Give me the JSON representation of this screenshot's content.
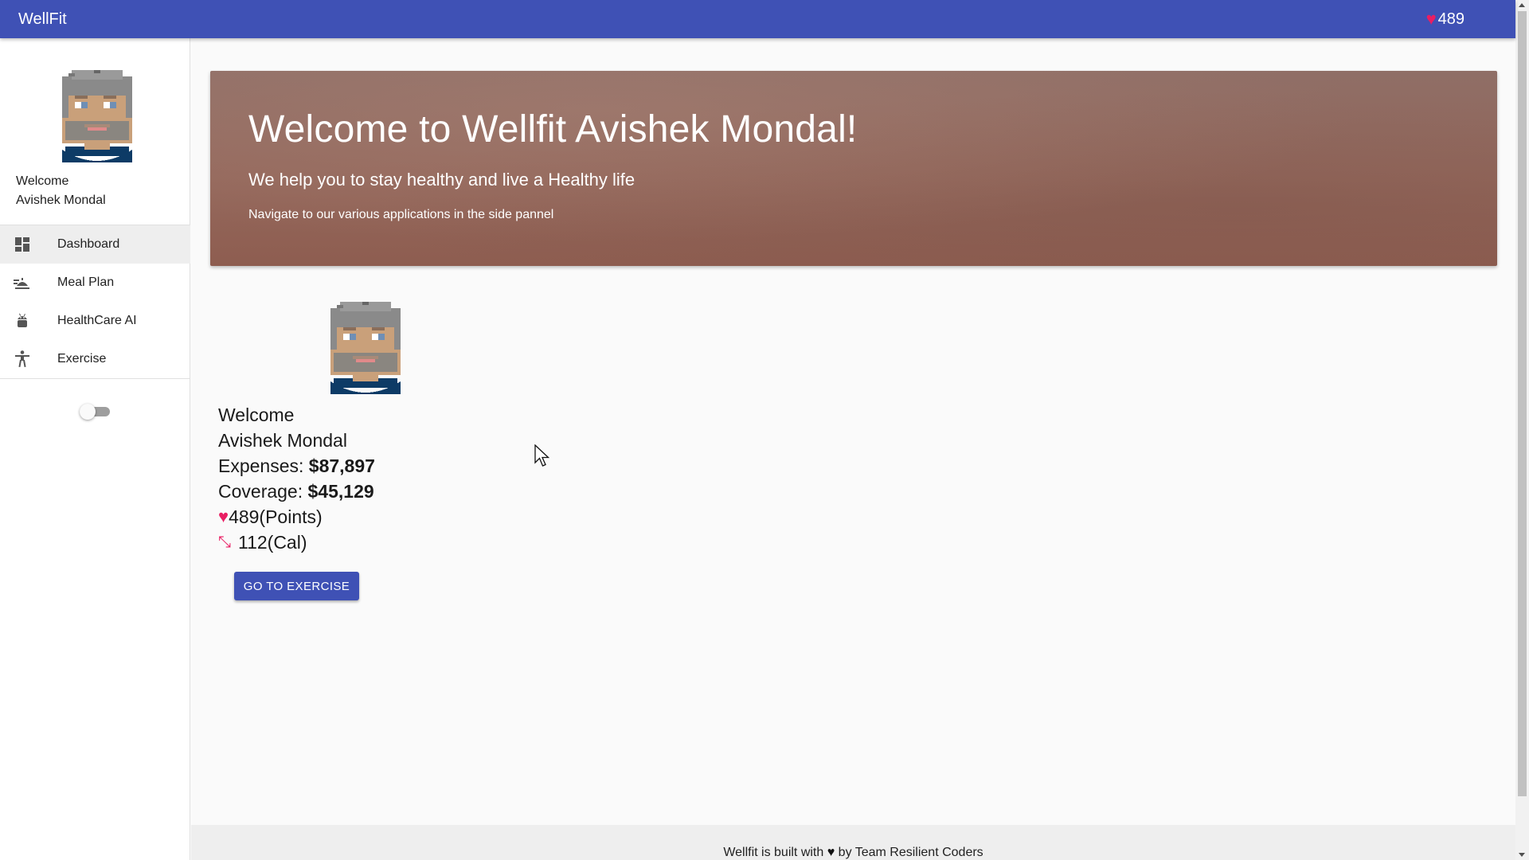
{
  "appbar": {
    "brand": "WellFit",
    "points": "489",
    "heart_icon": "heart-icon"
  },
  "sidebar": {
    "welcome": "Welcome",
    "user_name": "Avishek Mondal",
    "items": [
      {
        "label": "Dashboard",
        "icon": "dashboard-icon",
        "active": true
      },
      {
        "label": "Meal Plan",
        "icon": "meal-icon",
        "active": false
      },
      {
        "label": "HealthCare AI",
        "icon": "android-icon",
        "active": false
      },
      {
        "label": "Exercise",
        "icon": "accessibility-icon",
        "active": false
      }
    ],
    "theme_toggle": "off"
  },
  "hero": {
    "title": "Welcome to Wellfit Avishek Mondal!",
    "subtitle": "We help you to stay healthy and live a Healthy life",
    "note": "Navigate to our various applications in the side pannel"
  },
  "profile": {
    "welcome": "Welcome",
    "name": "Avishek Mondal",
    "expenses_label": "Expenses: ",
    "expenses_value": "$87,897",
    "coverage_label": "Coverage: ",
    "coverage_value": "$45,129",
    "points": "489(Points)",
    "calories": "112(Cal)",
    "cta_button": "GO TO EXERCISE"
  },
  "footer": {
    "text_before": "Wellfit is built with ",
    "text_after": " by Team Resilient Coders"
  },
  "colors": {
    "primary": "#3f51b5",
    "heart": "#e91e63",
    "hero_bg": "#94685c"
  }
}
